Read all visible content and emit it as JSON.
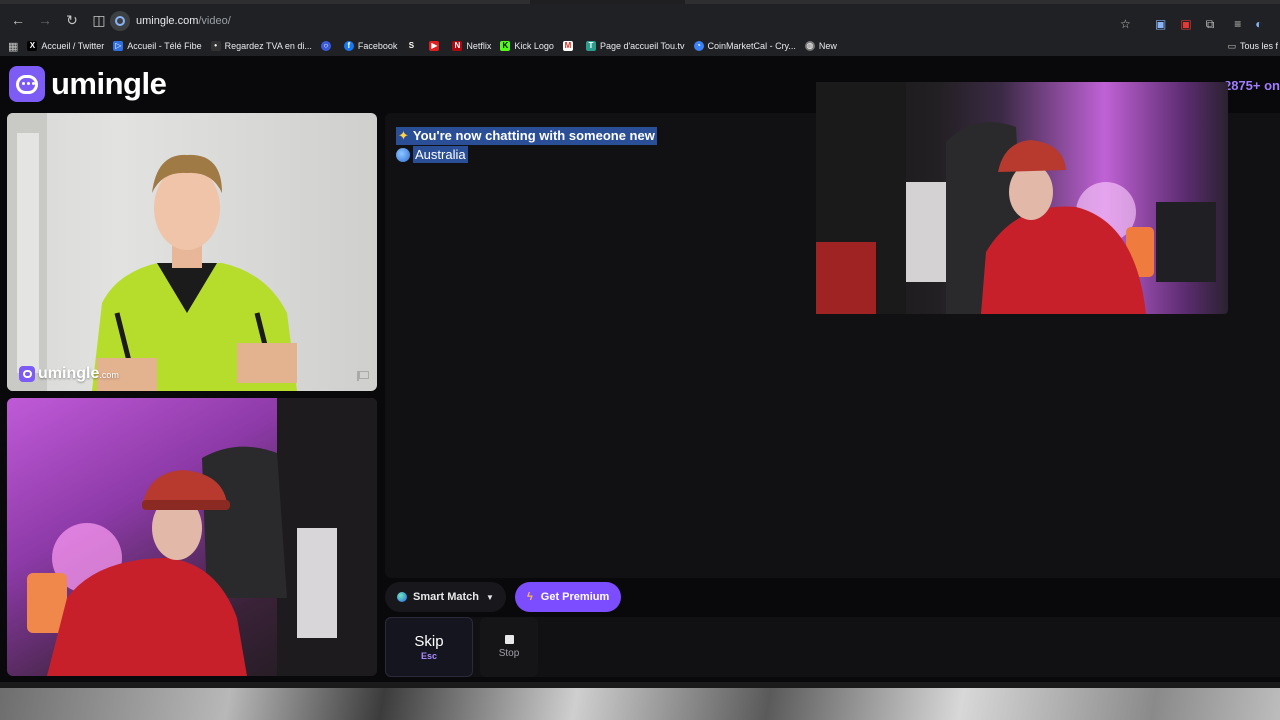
{
  "browser": {
    "url_host": "umingle.com",
    "url_path": "/video/",
    "bookmarks": [
      {
        "label": "Accueil / Twitter",
        "icon": "x-logo-icon",
        "color": "#000000",
        "glyph": "X"
      },
      {
        "label": "Accueil - Télé Fibe",
        "icon": "bell-logo-icon",
        "color": "#2f6fe0",
        "glyph": "▷"
      },
      {
        "label": "Regardez TVA en di...",
        "icon": "tva-logo-icon",
        "color": "#333333",
        "glyph": "•"
      },
      {
        "label": "",
        "icon": "circle-logo-icon",
        "color": "#3b5bdb",
        "glyph": "○"
      },
      {
        "label": "Facebook",
        "icon": "facebook-icon",
        "color": "#1877f2",
        "glyph": "f"
      },
      {
        "label": "",
        "icon": "s-logo-icon",
        "color": "#222222",
        "glyph": "S"
      },
      {
        "label": "",
        "icon": "youtube-icon",
        "color": "#e02020",
        "glyph": "▶"
      },
      {
        "label": "Netflix",
        "icon": "netflix-icon",
        "color": "#b00710",
        "glyph": "N"
      },
      {
        "label": "Kick Logo",
        "icon": "kick-icon",
        "color": "#53fc18",
        "glyph": "K"
      },
      {
        "label": "",
        "icon": "gmail-icon",
        "color": "#d93025",
        "glyph": "M"
      },
      {
        "label": "Page d'accueil Tou.tv",
        "icon": "toutv-icon",
        "color": "#2a9d8f",
        "glyph": "T"
      },
      {
        "label": "CoinMarketCal - Cry...",
        "icon": "coinmarketcal-icon",
        "color": "#3b82f6",
        "glyph": "◔"
      },
      {
        "label": "New",
        "icon": "globe-icon",
        "color": "#777777",
        "glyph": "◍"
      }
    ],
    "all_bookmarks_label": "Tous les f"
  },
  "site": {
    "brand": "umingle",
    "online_count": "2875+ on",
    "watermark_brand": "umingle",
    "watermark_tld": ".com"
  },
  "chat": {
    "system_message": "You're now chatting with someone new",
    "country": "Australia"
  },
  "controls": {
    "smart_match_label": "Smart Match",
    "premium_label": "Get Premium",
    "skip_label": "Skip",
    "skip_shortcut": "Esc",
    "stop_label": "Stop"
  },
  "colors": {
    "accent": "#7c4dff",
    "selection": "#2b4f96",
    "online_text": "#a07cff"
  }
}
